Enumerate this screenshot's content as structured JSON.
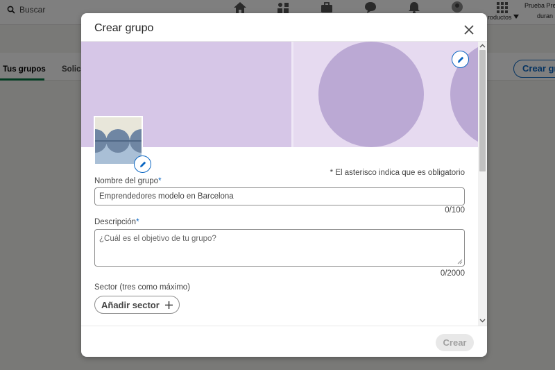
{
  "background": {
    "search_label": "Buscar",
    "nav_products_label": "roductos",
    "nav_premium_line1": "Prueba Pre",
    "nav_premium_line2": "duran",
    "tabs": [
      {
        "label": "Tus grupos"
      },
      {
        "label": "Solici"
      }
    ],
    "create_group_button": "Crear gr"
  },
  "modal": {
    "title": "Crear grupo",
    "required_note": "* El asterisco indica que es obligatorio",
    "group_name": {
      "label": "Nombre del grupo",
      "required_mark": "*",
      "value": "Emprendedores modelo en Barcelona",
      "counter": "0/100"
    },
    "description": {
      "label": "Descripción",
      "required_mark": "*",
      "placeholder": "¿Cuál es el objetivo de tu grupo?",
      "counter": "0/2000"
    },
    "sector": {
      "label": "Sector (tres como máximo)",
      "add_button": "Añadir sector"
    },
    "submit_button": "Crear"
  },
  "colors": {
    "banner_left": "#d6c6e7",
    "banner_right": "#e6daf0",
    "banner_circle": "#bba9d4",
    "accent": "#0a66c2"
  },
  "icons": {
    "close": "close-icon",
    "edit": "pencil-icon",
    "add": "plus-icon"
  }
}
